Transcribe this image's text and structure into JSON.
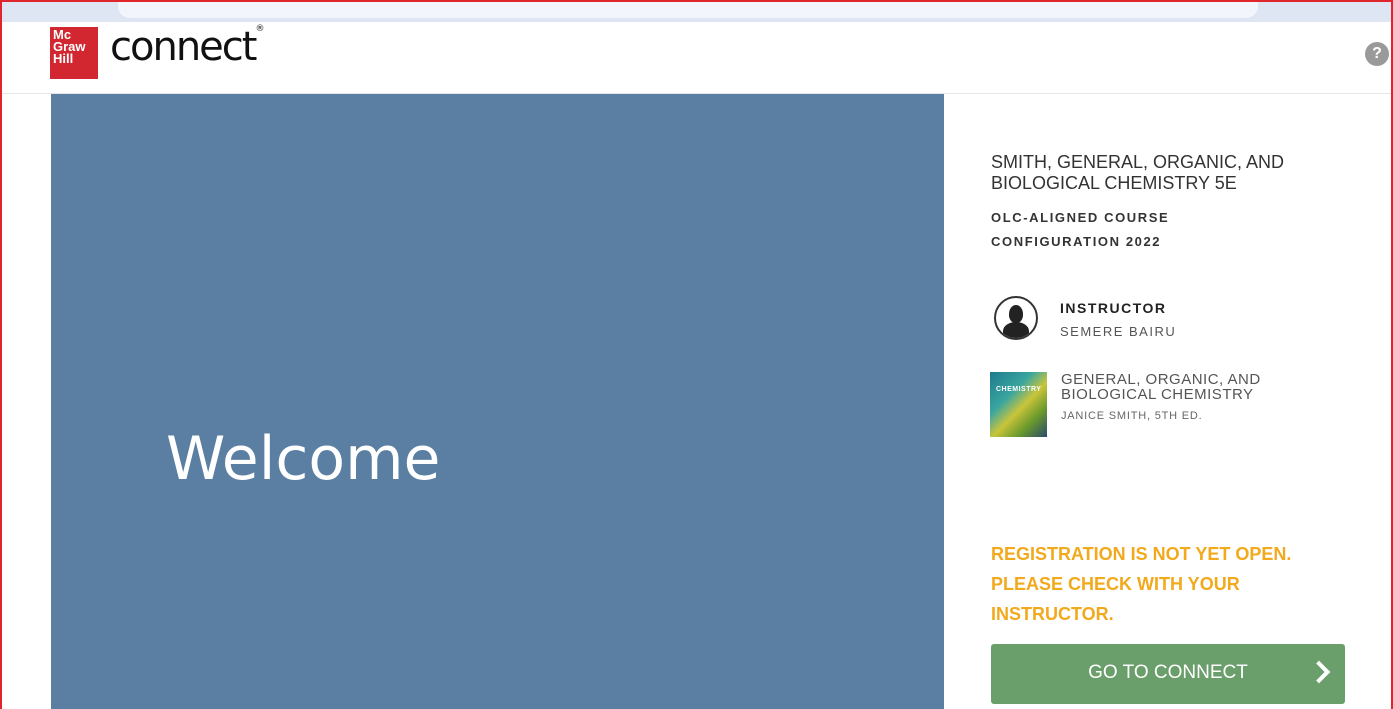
{
  "brand": {
    "logo_lines": [
      "Mc",
      "Graw",
      "Hill"
    ],
    "product": "connect",
    "trademark": "®"
  },
  "header": {
    "help_glyph": "?"
  },
  "hero": {
    "title": "Welcome"
  },
  "course": {
    "title": "SMITH, GENERAL, ORGANIC, AND BIOLOGICAL CHEMISTRY 5E",
    "subtitle": "OLC-ALIGNED COURSE CONFIGURATION 2022"
  },
  "instructor": {
    "label": "INSTRUCTOR",
    "name": "SEMERE BAIRU",
    "icon": "person-avatar-icon"
  },
  "book": {
    "title": "GENERAL, ORGANIC, AND BIOLOGICAL CHEMISTRY",
    "author": "JANICE SMITH, 5TH ED.",
    "cover_text": "CHEMISTRY"
  },
  "registration": {
    "message": "REGISTRATION IS NOT YET OPEN. PLEASE CHECK WITH YOUR INSTRUCTOR."
  },
  "actions": {
    "go_label": "GO TO CONNECT",
    "go_icon": "chevron-right-icon"
  },
  "colors": {
    "hero_bg": "#5b7fa3",
    "brand_red": "#d22630",
    "warning": "#f2a91c",
    "button_green": "#6a9e6b"
  }
}
